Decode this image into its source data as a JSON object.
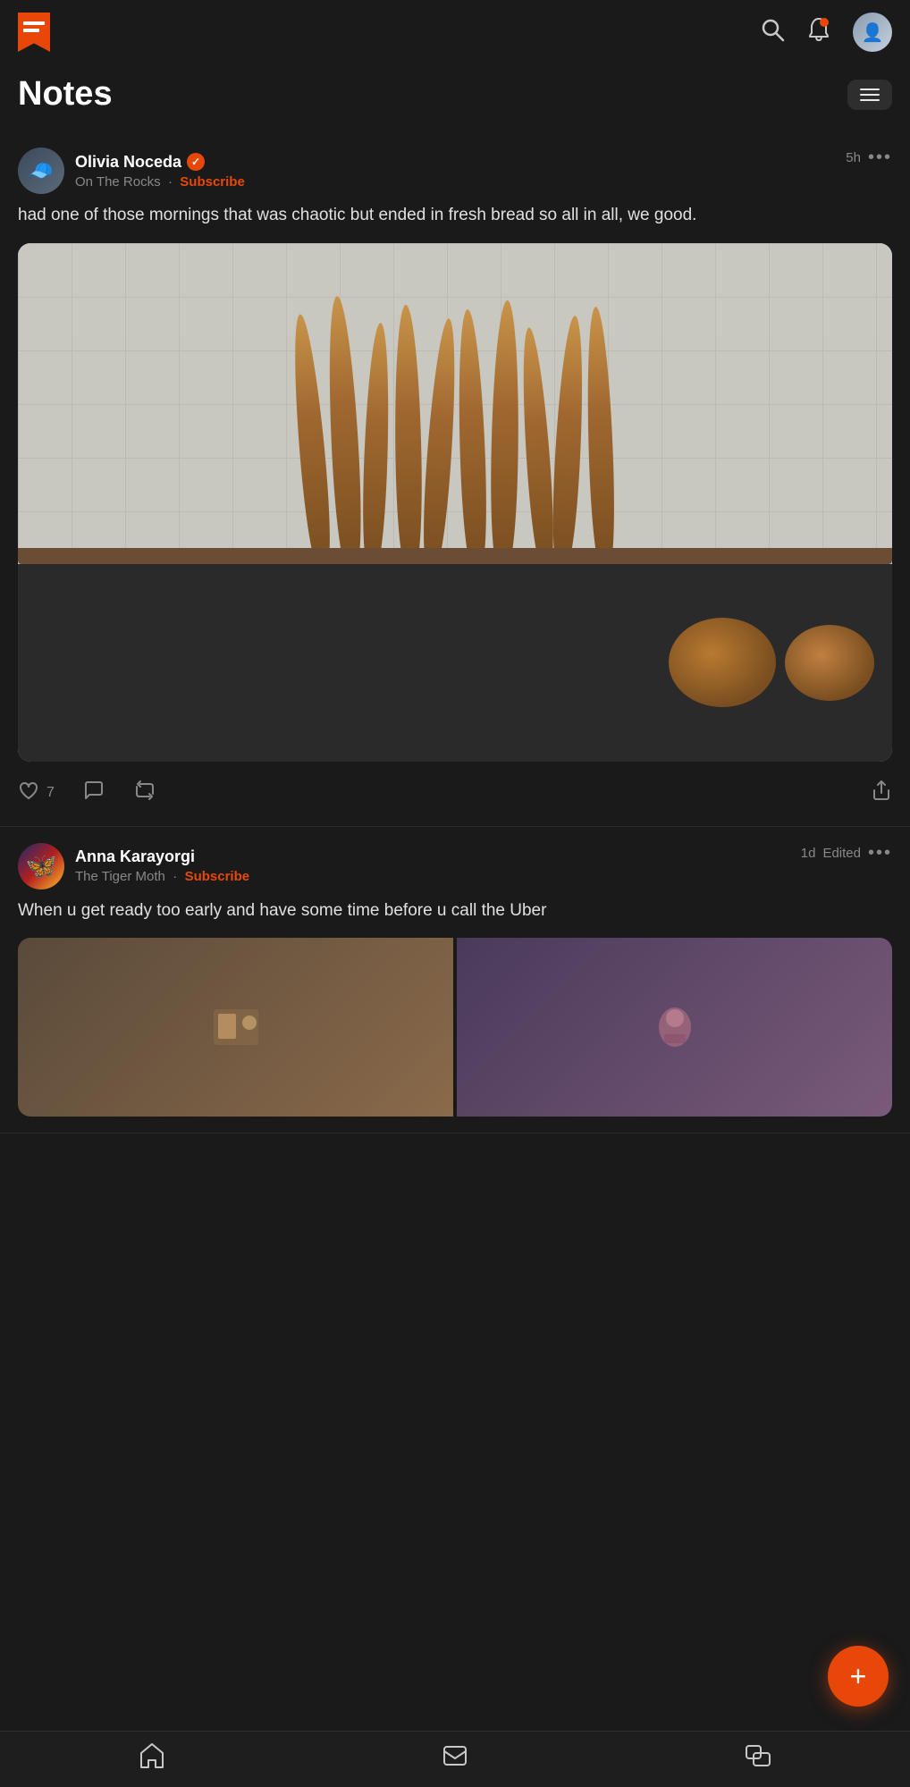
{
  "app": {
    "title": "Notes"
  },
  "nav": {
    "search_label": "search",
    "notifications_label": "notifications",
    "profile_label": "profile"
  },
  "filter_button_label": "filter",
  "posts": [
    {
      "id": "post-1",
      "author": "Olivia Noceda",
      "verified": true,
      "publication": "On The Rocks",
      "subscribe_label": "Subscribe",
      "time": "5h",
      "edited": false,
      "more_label": "...",
      "text": "had one of those mornings that was chaotic but ended in fresh bread so all in all, we good.",
      "likes": 7,
      "likes_label": "7",
      "comment_label": "comment",
      "repost_label": "repost",
      "share_label": "share"
    },
    {
      "id": "post-2",
      "author": "Anna Karayorgi",
      "verified": false,
      "publication": "The Tiger Moth",
      "subscribe_label": "Subscribe",
      "time": "1d",
      "edited": true,
      "edited_label": "Edited",
      "more_label": "...",
      "text": "When u get ready too early and have some time before u call the Uber"
    }
  ],
  "bottom_nav": {
    "home_label": "home",
    "inbox_label": "inbox",
    "messages_label": "messages"
  },
  "fab_label": "+"
}
